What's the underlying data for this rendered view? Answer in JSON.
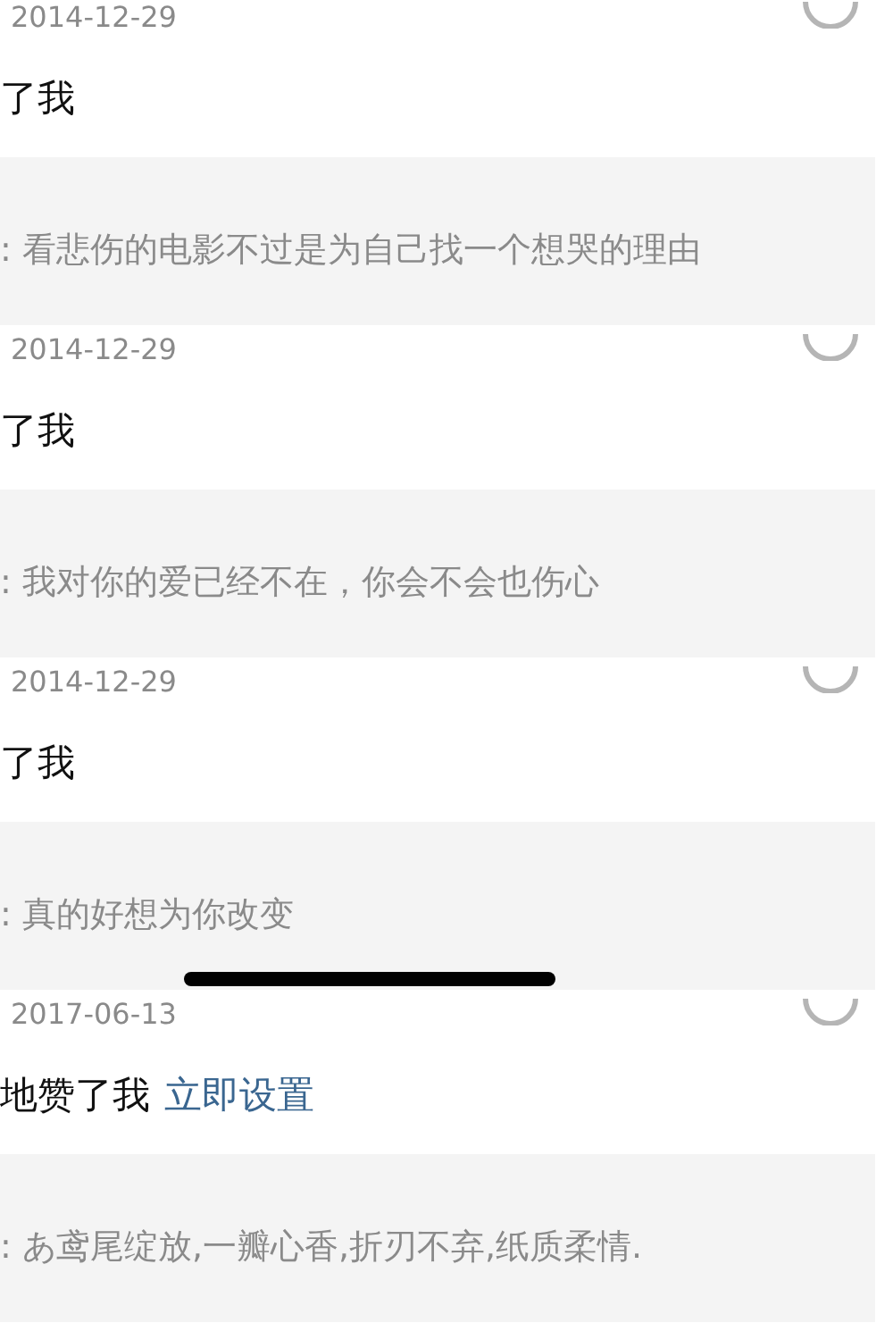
{
  "entries": [
    {
      "date": "2014-12-29",
      "title": "了我",
      "quote": ": 看悲伤的电影不过是为自己找一个想哭的理由"
    },
    {
      "date": "2014-12-29",
      "title": "了我",
      "quote": ": 我对你的爱已经不在，你会不会也伤心"
    },
    {
      "date": "2014-12-29",
      "title": "了我",
      "quote": ": 真的好想为你改变"
    },
    {
      "date": "2017-06-13",
      "title": "地赞了我",
      "link": "立即设置",
      "quote": ": あ鸢尾绽放,一瓣心香,折刃不弃,纸质柔情."
    }
  ]
}
